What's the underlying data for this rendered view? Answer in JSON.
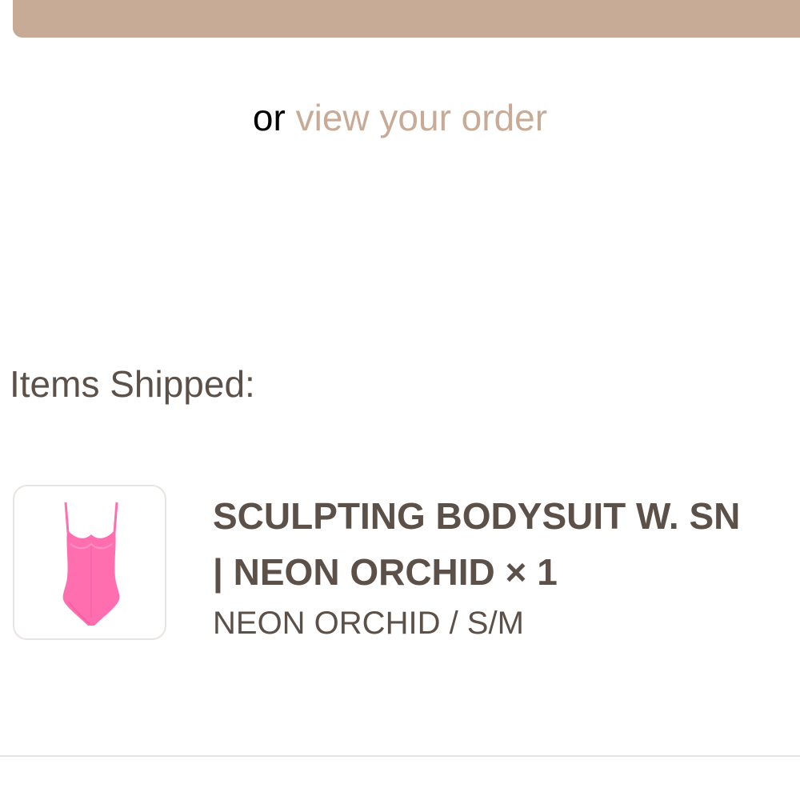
{
  "cta": {
    "color": "#c8ab96"
  },
  "order_link": {
    "prefix": "or",
    "label": "view your order"
  },
  "items_section": {
    "title": "Items Shipped:"
  },
  "items": [
    {
      "title_line1": "SCULPTING BODYSUIT W. SN",
      "title_line2": "| NEON ORCHID × 1",
      "variant": "NEON ORCHID / S/M",
      "thumbnail_icon": "pink-bodysuit-image",
      "product_color": "#ff6fb0"
    }
  ],
  "colors": {
    "accent": "#c8ab96",
    "text": "#5c5149"
  }
}
